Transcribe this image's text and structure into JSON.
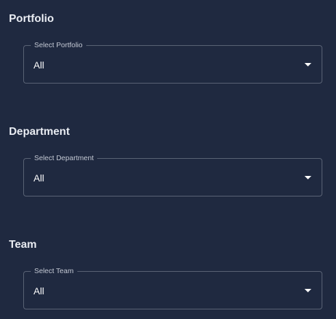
{
  "sections": [
    {
      "title": "Portfolio",
      "select": {
        "legend": "Select Portfolio",
        "value": "All"
      }
    },
    {
      "title": "Department",
      "select": {
        "legend": "Select Department",
        "value": "All"
      }
    },
    {
      "title": "Team",
      "select": {
        "legend": "Select Team",
        "value": "All"
      }
    }
  ],
  "icons": {
    "dropdown": "caret-down-icon"
  },
  "colors": {
    "background": "#1f2940",
    "border": "#5c6577",
    "text": "#ffffff",
    "legend_text": "#c5cad5"
  }
}
